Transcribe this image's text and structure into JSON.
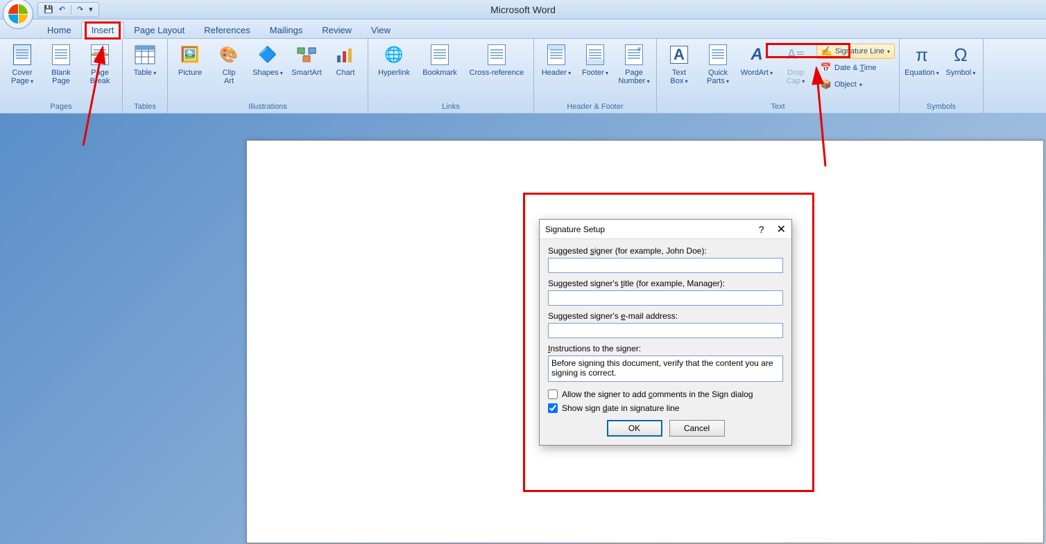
{
  "app_title": "Microsoft Word",
  "qat": {
    "save": "💾",
    "undo": "↶",
    "redo": "↷",
    "more": "▾"
  },
  "tabs": [
    "Home",
    "Insert",
    "Page Layout",
    "References",
    "Mailings",
    "Review",
    "View"
  ],
  "active_tab": "Insert",
  "ribbon": {
    "pages": {
      "label": "Pages",
      "cover": "Cover\nPage",
      "blank": "Blank\nPage",
      "break": "Page\nBreak"
    },
    "tables": {
      "label": "Tables",
      "table": "Table"
    },
    "illustrations": {
      "label": "Illustrations",
      "picture": "Picture",
      "clip": "Clip\nArt",
      "shapes": "Shapes",
      "smart": "SmartArt",
      "chart": "Chart"
    },
    "links": {
      "label": "Links",
      "hyper": "Hyperlink",
      "book": "Bookmark",
      "cross": "Cross-reference"
    },
    "hf": {
      "label": "Header & Footer",
      "header": "Header",
      "footer": "Footer",
      "pagenum": "Page\nNumber"
    },
    "text": {
      "label": "Text",
      "textbox": "Text\nBox",
      "quick": "Quick\nParts",
      "wordart": "WordArt",
      "drop": "Drop\nCap",
      "sig": "Signature Line",
      "date": "Date & Time",
      "obj": "Object"
    },
    "symbols": {
      "label": "Symbols",
      "eq": "Equation",
      "sym": "Symbol"
    }
  },
  "dialog": {
    "title": "Signature Setup",
    "signer_label": "Suggested signer (for example, John Doe):",
    "signer_label_pre": "Suggested ",
    "signer_label_u": "s",
    "signer_label_post": "igner (for example, John Doe):",
    "title_label_pre": "Suggested signer's ",
    "title_label_u": "t",
    "title_label_post": "itle (for example, Manager):",
    "email_label_pre": "Suggested signer's ",
    "email_label_u": "e",
    "email_label_post": "-mail address:",
    "instr_label_pre": "",
    "instr_label_u": "I",
    "instr_label_post": "nstructions to the signer:",
    "instructions": "Before signing this document, verify that the content you are signing is correct.",
    "chk_comments_pre": "Allow the signer to add ",
    "chk_comments_u": "c",
    "chk_comments_post": "omments in the Sign dialog",
    "chk_date_pre": "Show sign ",
    "chk_date_u": "d",
    "chk_date_post": "ate in signature line",
    "chk_comments_checked": false,
    "chk_date_checked": true,
    "ok": "OK",
    "cancel": "Cancel"
  }
}
